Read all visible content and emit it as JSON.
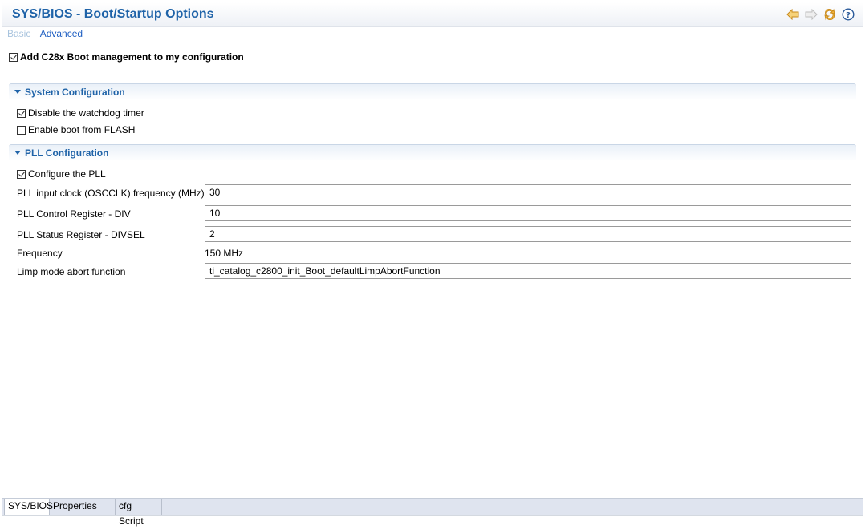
{
  "header": {
    "title": "SYS/BIOS - Boot/Startup Options"
  },
  "mode": {
    "basic": "Basic",
    "advanced": "Advanced"
  },
  "boot_mgmt": {
    "label": "Add C28x Boot management to my configuration",
    "checked": true
  },
  "system_config": {
    "title": "System Configuration",
    "disable_watchdog": {
      "label": "Disable the watchdog timer",
      "checked": true
    },
    "boot_from_flash": {
      "label": "Enable boot from FLASH",
      "checked": false
    }
  },
  "pll_config": {
    "title": "PLL Configuration",
    "configure_pll": {
      "label": "Configure the PLL",
      "checked": true
    },
    "osc_clock": {
      "label": "PLL input clock (OSCCLK) frequency (MHz)",
      "value": "30"
    },
    "pll_div": {
      "label": "PLL Control Register - DIV",
      "value": "10"
    },
    "pll_divsel": {
      "label": "PLL Status Register - DIVSEL",
      "value": "2"
    },
    "frequency": {
      "label": "Frequency",
      "value": "150 MHz"
    },
    "limp_fn": {
      "label": "Limp mode abort function",
      "value": "ti_catalog_c2800_init_Boot_defaultLimpAbortFunction"
    }
  },
  "tabs": [
    {
      "label": "SYS/BIOS",
      "active": true
    },
    {
      "label": "Properties",
      "active": false
    },
    {
      "label": "cfg Script",
      "active": false
    }
  ],
  "colors": {
    "accent": "#1f63a8",
    "link": "#1f5fc2",
    "icon_orange": "#e3a52b"
  }
}
